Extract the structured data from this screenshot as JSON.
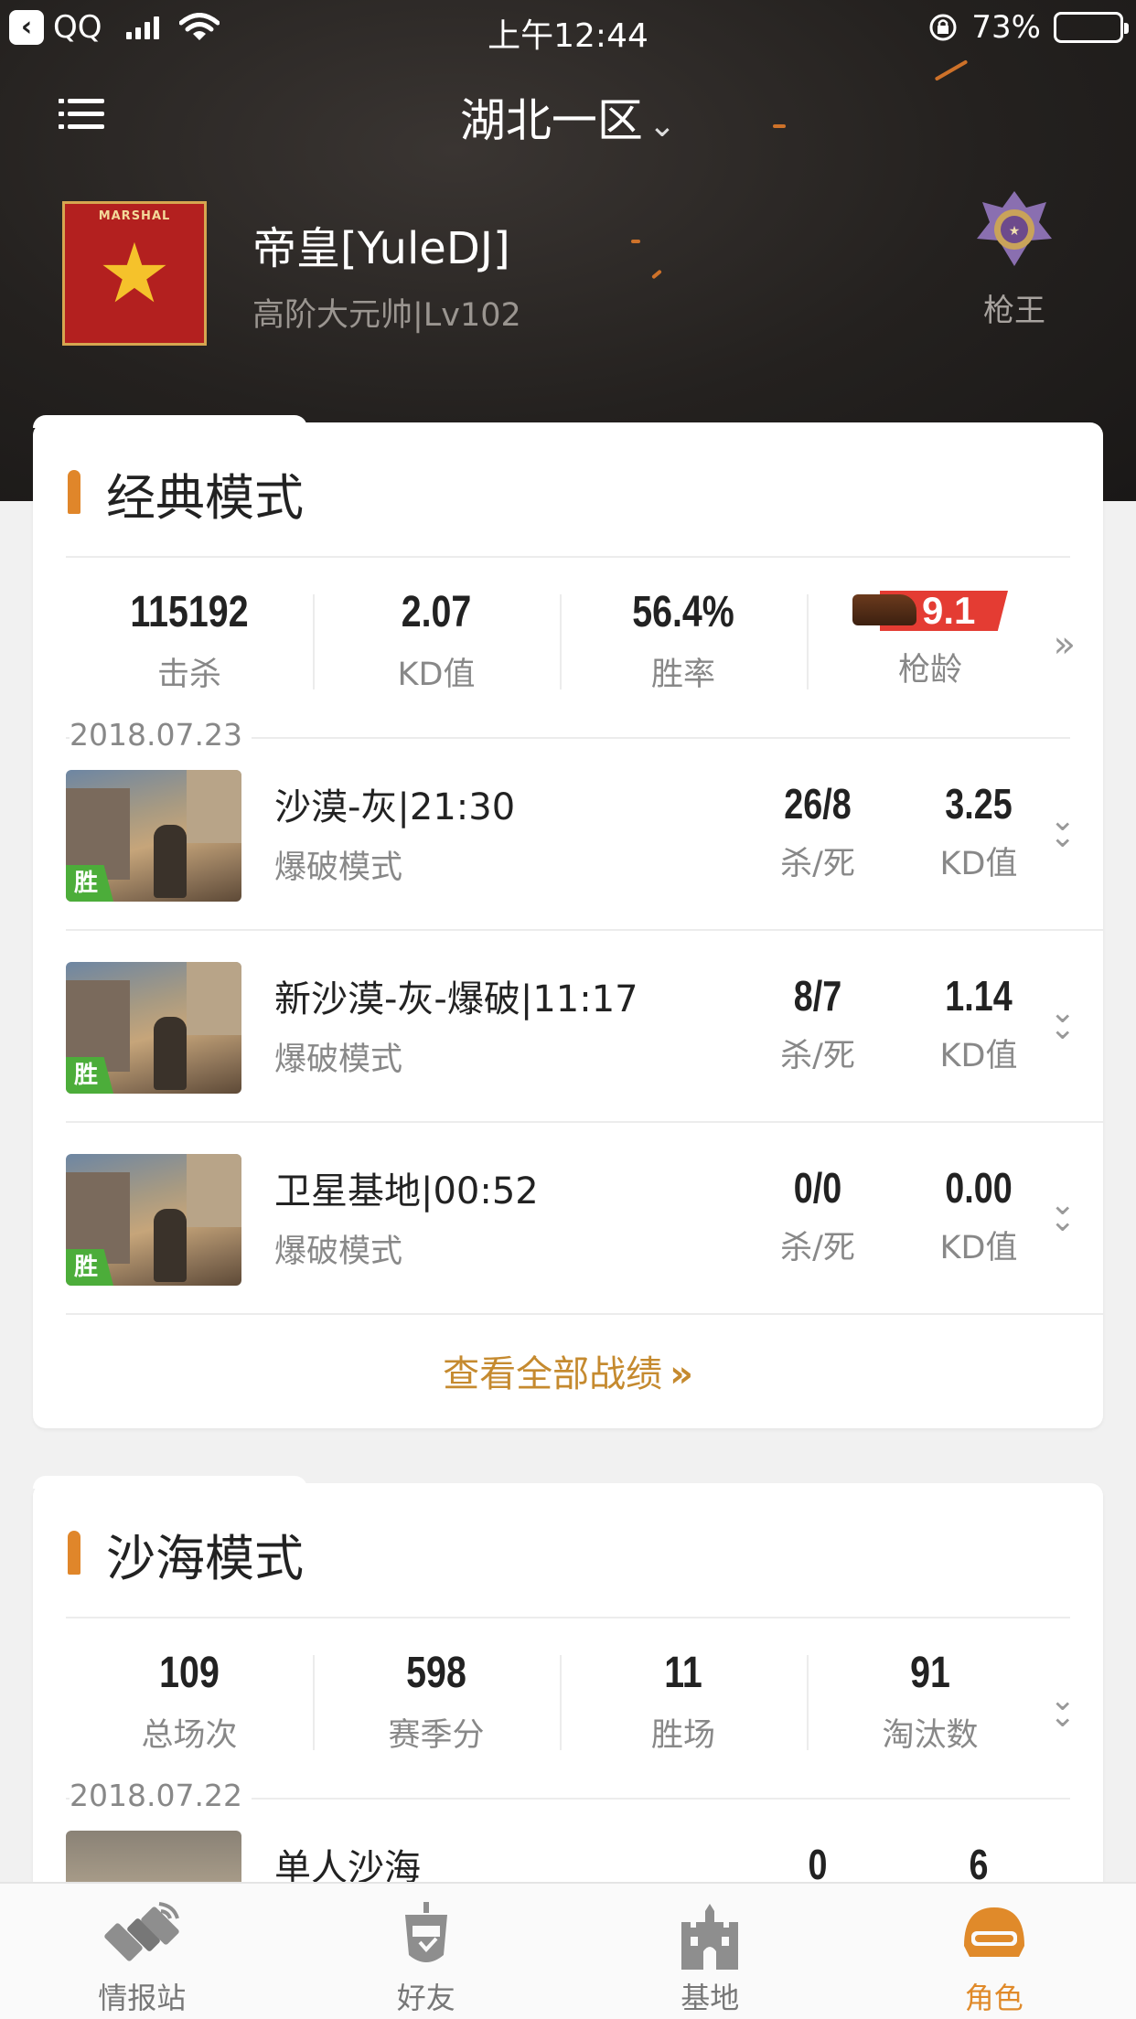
{
  "status_bar": {
    "back_app": "QQ",
    "time": "上午12:44",
    "battery": "73%",
    "battery_level": 0.73
  },
  "header": {
    "server": "湖北一区",
    "player_name": "帝皇[YuleDJ]",
    "player_rank": "高阶大元帅|Lv102",
    "avatar_text": "MARSHAL",
    "badge_label": "枪王"
  },
  "classic": {
    "title": "经典模式",
    "stats": [
      {
        "value": "115192",
        "label": "击杀"
      },
      {
        "value": "2.07",
        "label": "KD值"
      },
      {
        "value": "56.4%",
        "label": "胜率"
      },
      {
        "value": "9.1",
        "label": "枪龄"
      }
    ],
    "date": "2018.07.23",
    "matches": [
      {
        "name": "沙漠-灰|21:30",
        "mode": "爆破模式",
        "result": "胜",
        "kd_ratio": "26/8",
        "kd_ratio_label": "杀/死",
        "kd": "3.25",
        "kd_label": "KD值"
      },
      {
        "name": "新沙漠-灰-爆破|11:17",
        "mode": "爆破模式",
        "result": "胜",
        "kd_ratio": "8/7",
        "kd_ratio_label": "杀/死",
        "kd": "1.14",
        "kd_label": "KD值"
      },
      {
        "name": "卫星基地|00:52",
        "mode": "爆破模式",
        "result": "胜",
        "kd_ratio": "0/0",
        "kd_ratio_label": "杀/死",
        "kd": "0.00",
        "kd_label": "KD值"
      }
    ],
    "view_all": "查看全部战绩",
    "view_all_arrow": "»"
  },
  "sandsea": {
    "title": "沙海模式",
    "stats": [
      {
        "value": "109",
        "label": "总场次"
      },
      {
        "value": "598",
        "label": "赛季分"
      },
      {
        "value": "11",
        "label": "胜场"
      },
      {
        "value": "91",
        "label": "淘汰数"
      }
    ],
    "date": "2018.07.22",
    "matches": [
      {
        "name": "单人沙海",
        "col1": "0",
        "col2": "6"
      }
    ]
  },
  "tabs": [
    {
      "label": "情报站",
      "icon": "satellite-icon"
    },
    {
      "label": "好友",
      "icon": "robot-friend-icon"
    },
    {
      "label": "基地",
      "icon": "castle-icon"
    },
    {
      "label": "角色",
      "icon": "helmet-icon"
    }
  ],
  "colors": {
    "accent": "#e08a2a",
    "win_green": "#4cad3a",
    "gun_age_red": "#e43c33",
    "link_gold": "#c58a2f"
  }
}
